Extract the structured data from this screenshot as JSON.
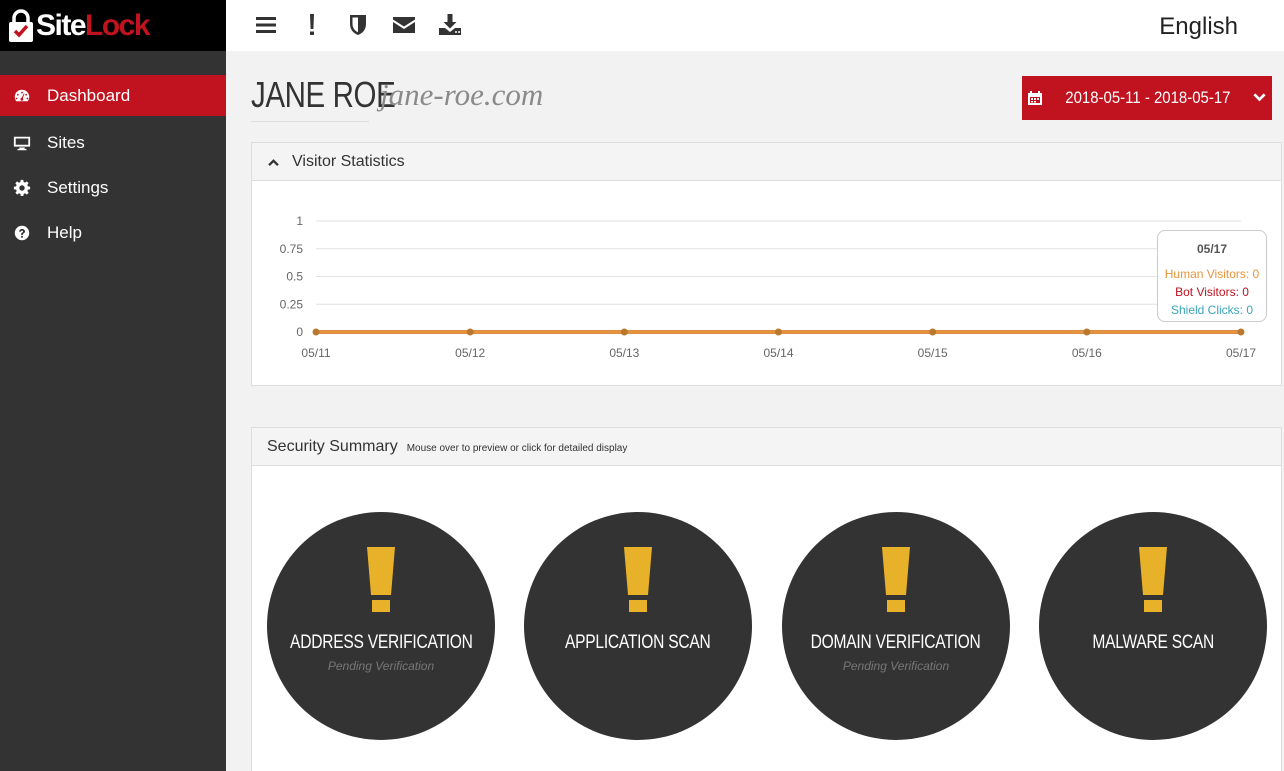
{
  "brand": {
    "site": "Site",
    "lock": "Lock",
    "accent": "#c1121f"
  },
  "sidebar": {
    "items": [
      {
        "label": "Dashboard",
        "icon": "dashboard-icon",
        "active": true
      },
      {
        "label": "Sites",
        "icon": "monitor-icon",
        "active": false
      },
      {
        "label": "Settings",
        "icon": "gear-icon",
        "active": false
      },
      {
        "label": "Help",
        "icon": "question-icon",
        "active": false
      }
    ]
  },
  "topbar": {
    "icons": [
      "menu-icon",
      "alert-icon",
      "shield-icon",
      "envelope-icon",
      "download-icon"
    ],
    "language": "English"
  },
  "header": {
    "name": "JANE ROE",
    "domain": "jane-roe.com",
    "date_range": "2018-05-11 - 2018-05-17"
  },
  "visitor_panel": {
    "title": "Visitor Statistics",
    "tooltip": {
      "date": "05/17",
      "human": "Human Visitors: 0",
      "bot": "Bot Visitors: 0",
      "shield": "Shield Clicks: 0"
    }
  },
  "chart_data": {
    "type": "line",
    "x": [
      "05/11",
      "05/12",
      "05/13",
      "05/14",
      "05/15",
      "05/16",
      "05/17"
    ],
    "series": [
      {
        "name": "Human Visitors",
        "values": [
          0,
          0,
          0,
          0,
          0,
          0,
          0
        ],
        "color": "#e8943a"
      },
      {
        "name": "Bot Visitors",
        "values": [
          0,
          0,
          0,
          0,
          0,
          0,
          0
        ],
        "color": "#c1121f"
      },
      {
        "name": "Shield Clicks",
        "values": [
          0,
          0,
          0,
          0,
          0,
          0,
          0
        ],
        "color": "#3aa6b9"
      }
    ],
    "yticks": [
      "0",
      "0.25",
      "0.5",
      "0.75",
      "1"
    ],
    "ylim": [
      0,
      1
    ],
    "grid": true
  },
  "security_panel": {
    "title": "Security Summary",
    "note": "Mouse over to preview or click for detailed display",
    "items": [
      {
        "title": "ADDRESS VERIFICATION",
        "sub": "Pending Verification"
      },
      {
        "title": "APPLICATION SCAN",
        "sub": ""
      },
      {
        "title": "DOMAIN VERIFICATION",
        "sub": "Pending Verification"
      },
      {
        "title": "MALWARE SCAN",
        "sub": ""
      }
    ],
    "alert_color": "#e8b12a"
  }
}
